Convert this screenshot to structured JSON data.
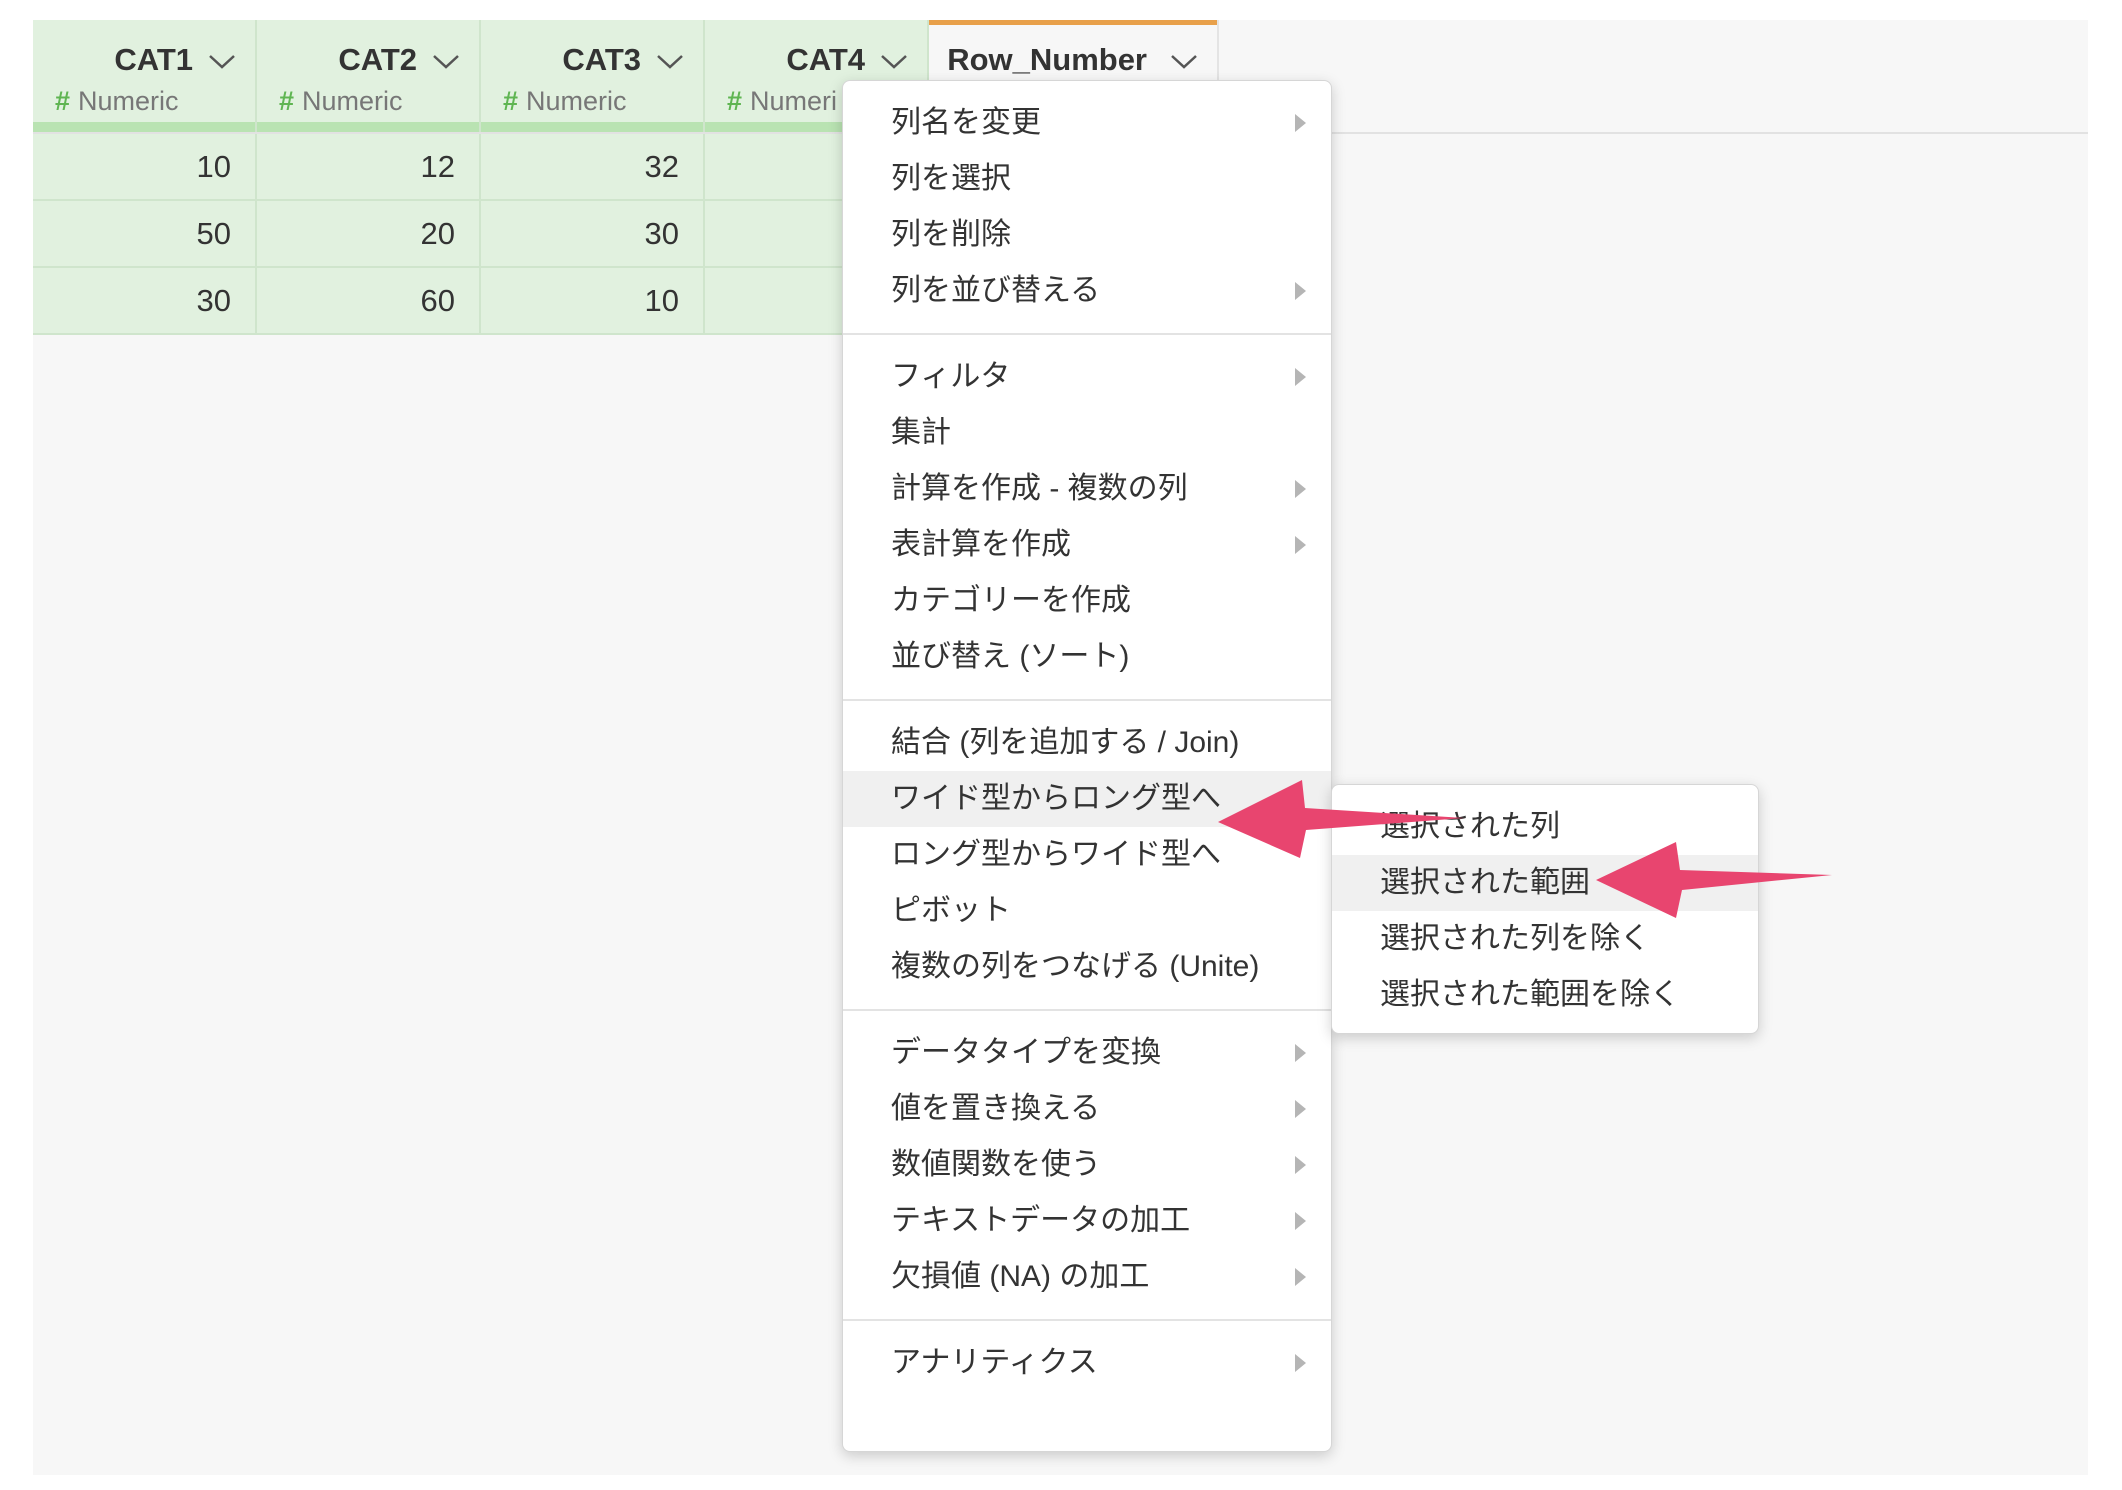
{
  "columns": [
    {
      "name": "CAT1",
      "type_label": "Numeric"
    },
    {
      "name": "CAT2",
      "type_label": "Numeric"
    },
    {
      "name": "CAT3",
      "type_label": "Numeric"
    },
    {
      "name": "CAT4",
      "type_label": "Numeri"
    },
    {
      "name": "Row_Number"
    }
  ],
  "type_symbol": "#",
  "rows": [
    [
      "10",
      "12",
      "32"
    ],
    [
      "50",
      "20",
      "30"
    ],
    [
      "30",
      "60",
      "10"
    ]
  ],
  "context_menu": {
    "groups": [
      [
        {
          "label": "列名を変更",
          "submenu": true
        },
        {
          "label": "列を選択",
          "submenu": false
        },
        {
          "label": "列を削除",
          "submenu": false
        },
        {
          "label": "列を並び替える",
          "submenu": true
        }
      ],
      [
        {
          "label": "フィルタ",
          "submenu": true
        },
        {
          "label": "集計",
          "submenu": false
        },
        {
          "label": "計算を作成 - 複数の列",
          "submenu": true
        },
        {
          "label": "表計算を作成",
          "submenu": true
        },
        {
          "label": "カテゴリーを作成",
          "submenu": false
        },
        {
          "label": "並び替え (ソート)",
          "submenu": false
        }
      ],
      [
        {
          "label": "結合 (列を追加する / Join)",
          "submenu": false
        },
        {
          "label": "ワイド型からロング型へ",
          "submenu": false,
          "highlighted": true
        },
        {
          "label": "ロング型からワイド型へ",
          "submenu": false
        },
        {
          "label": "ピボット",
          "submenu": false
        },
        {
          "label": "複数の列をつなげる (Unite)",
          "submenu": false
        }
      ],
      [
        {
          "label": "データタイプを変換",
          "submenu": true
        },
        {
          "label": "値を置き換える",
          "submenu": true
        },
        {
          "label": "数値関数を使う",
          "submenu": true
        },
        {
          "label": "テキストデータの加工",
          "submenu": true
        },
        {
          "label": "欠損値 (NA) の加工",
          "submenu": true
        }
      ],
      [
        {
          "label": "アナリティクス",
          "submenu": true
        }
      ]
    ]
  },
  "submenu": {
    "items": [
      {
        "label": "選択された列"
      },
      {
        "label": "選択された範囲",
        "highlighted": true
      },
      {
        "label": "選択された列を除く"
      },
      {
        "label": "選択された範囲を除く"
      }
    ]
  },
  "colors": {
    "header_green": "#e1f1df",
    "accent_orange": "#e8a04a",
    "numeric_hash": "#5fb552",
    "annotation_arrow": "#e8456f"
  }
}
